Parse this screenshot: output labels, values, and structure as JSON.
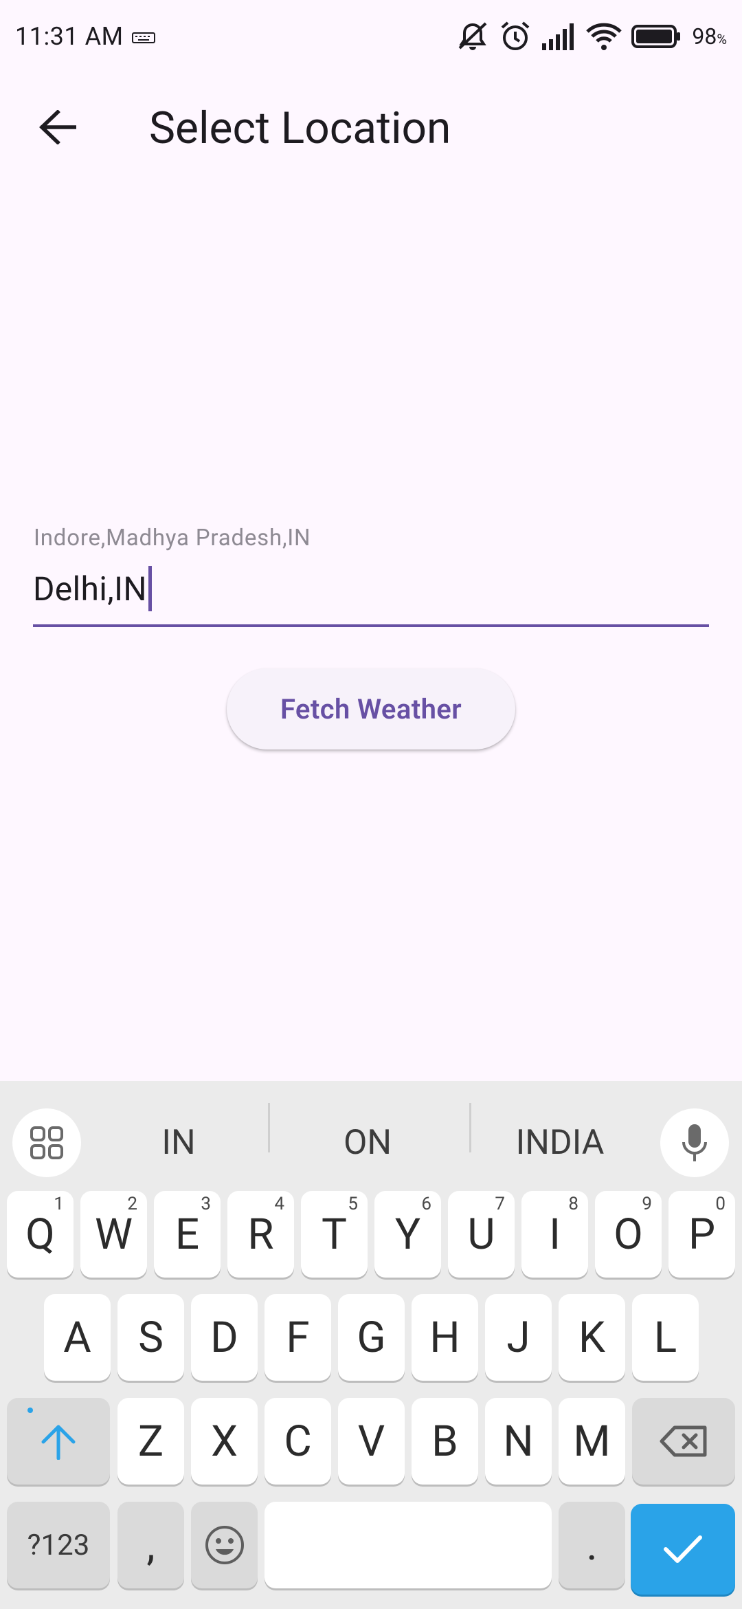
{
  "status_bar": {
    "time": "11:31 AM",
    "battery_percent": "98",
    "battery_unit": "%",
    "icons": [
      "keyboard-icon",
      "mute-icon",
      "alarm-icon",
      "signal-icon",
      "wifi-icon",
      "battery-icon"
    ]
  },
  "app_bar": {
    "back_icon": "arrow-back-icon",
    "title": "Select Location"
  },
  "location_field": {
    "label": "Indore,Madhya Pradesh,IN",
    "value": "Delhi,IN"
  },
  "fetch_button": {
    "label": "Fetch Weather"
  },
  "keyboard": {
    "suggestions": [
      "IN",
      "ON",
      "INDIA"
    ],
    "row1": [
      "Q",
      "W",
      "E",
      "R",
      "T",
      "Y",
      "U",
      "I",
      "O",
      "P"
    ],
    "row1_hints": [
      "1",
      "2",
      "3",
      "4",
      "5",
      "6",
      "7",
      "8",
      "9",
      "0"
    ],
    "row2": [
      "A",
      "S",
      "D",
      "F",
      "G",
      "H",
      "J",
      "K",
      "L"
    ],
    "row3": [
      "Z",
      "X",
      "C",
      "V",
      "B",
      "N",
      "M"
    ],
    "symbols_label": "?123",
    "comma_label": ",",
    "period_label": "."
  },
  "colors": {
    "accent": "#6750A4",
    "background": "#FEF7FF",
    "keyboard_bg": "#EBEBEB",
    "enter_key": "#2AA3E8"
  }
}
